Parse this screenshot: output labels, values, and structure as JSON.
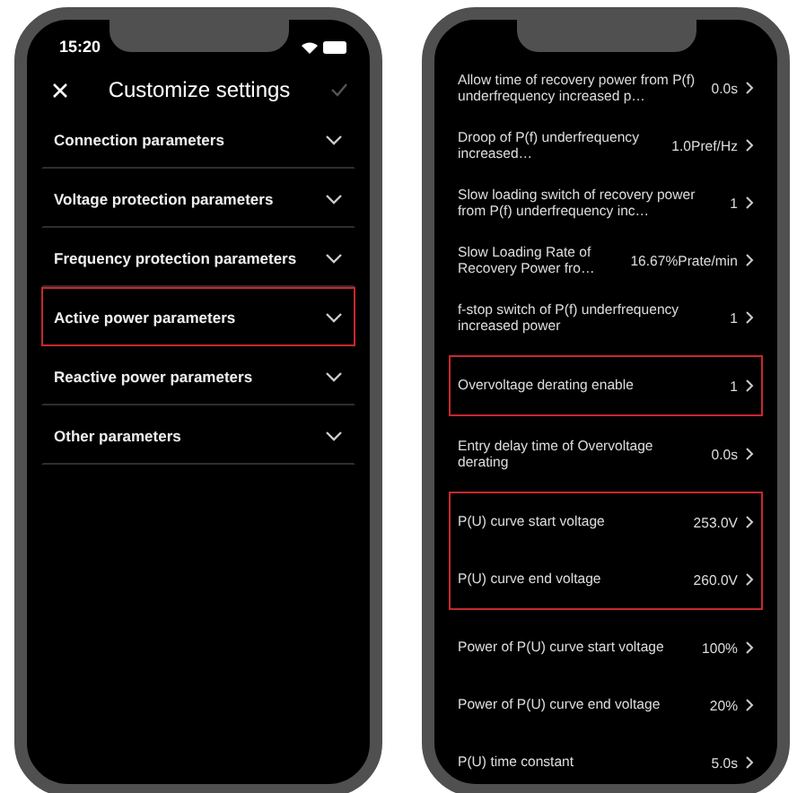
{
  "left_phone": {
    "status_time": "15:20",
    "title": "Customize settings",
    "categories": [
      {
        "label": "Connection parameters",
        "highlighted": false
      },
      {
        "label": "Voltage protection parameters",
        "highlighted": false
      },
      {
        "label": "Frequency protection parameters",
        "highlighted": false
      },
      {
        "label": "Active power parameters",
        "highlighted": true
      },
      {
        "label": "Reactive power parameters",
        "highlighted": false
      },
      {
        "label": "Other parameters",
        "highlighted": false
      }
    ]
  },
  "right_phone": {
    "sections": [
      {
        "highlighted": false,
        "items": [
          {
            "label": "Allow time of recovery power from P(f) underfrequency increased p…",
            "value": "0.0s"
          },
          {
            "label": "Droop of P(f) underfrequency increased…",
            "value": "1.0Pref/Hz"
          },
          {
            "label": "Slow loading switch of recovery power from P(f) underfrequency inc…",
            "value": "1"
          },
          {
            "label": "Slow Loading Rate of Recovery Power fro…",
            "value": "16.67%Prate/min"
          },
          {
            "label": "f-stop switch of P(f) underfrequency increased power",
            "value": "1"
          }
        ]
      },
      {
        "highlighted": true,
        "items": [
          {
            "label": "Overvoltage derating enable",
            "value": "1"
          }
        ]
      },
      {
        "highlighted": false,
        "items": [
          {
            "label": "Entry delay time of Overvoltage derating",
            "value": "0.0s"
          }
        ]
      },
      {
        "highlighted": true,
        "items": [
          {
            "label": "P(U) curve start voltage",
            "value": "253.0V"
          },
          {
            "label": "P(U) curve end voltage",
            "value": "260.0V"
          }
        ]
      },
      {
        "highlighted": false,
        "items": [
          {
            "label": "Power of P(U) curve start voltage",
            "value": "100%"
          },
          {
            "label": "Power of P(U) curve end voltage",
            "value": "20%"
          },
          {
            "label": "P(U) time constant",
            "value": "5.0s"
          }
        ]
      }
    ]
  }
}
